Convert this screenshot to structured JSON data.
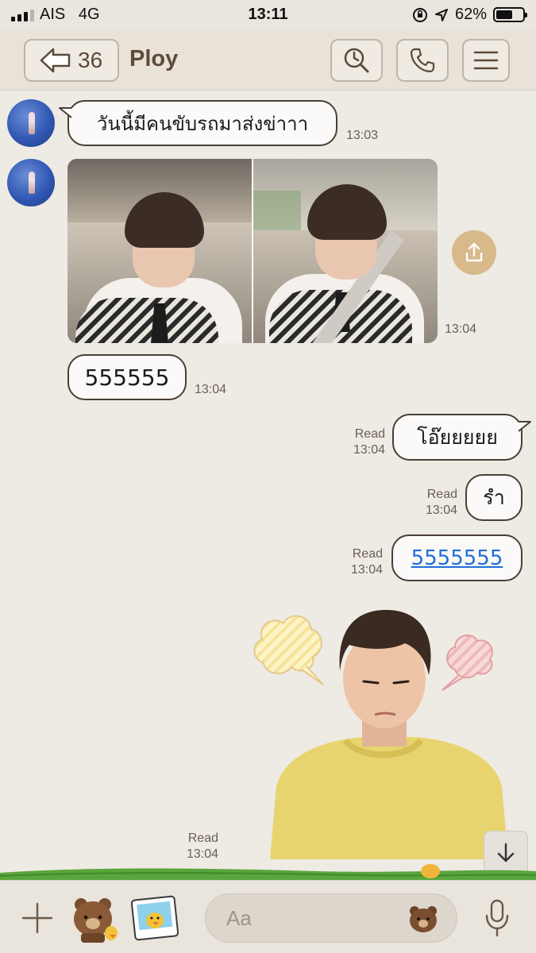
{
  "status_bar": {
    "carrier": "AIS",
    "network": "4G",
    "time": "13:11",
    "battery_text": "62%",
    "battery_level": 0.62
  },
  "header": {
    "back_count": "36",
    "title": "Ploy"
  },
  "messages": [
    {
      "text": "วันนี้มีคนขับรถมาส่งข่าาา",
      "time": "13:03"
    },
    {
      "type": "photos",
      "time": "13:04"
    },
    {
      "text": "555555",
      "time": "13:04"
    },
    {
      "text": "โอ๊ยยยยย",
      "read": "Read",
      "time": "13:04"
    },
    {
      "text": "รำ",
      "read": "Read",
      "time": "13:04"
    },
    {
      "text": "5555555",
      "read": "Read",
      "time": "13:04"
    },
    {
      "type": "sticker",
      "read": "Read",
      "time": "13:04"
    }
  ],
  "input": {
    "placeholder": "Aa"
  },
  "colors": {
    "background": "#eeeae4",
    "header": "#e8e2d9",
    "accent": "#d8b98a",
    "link": "#1f6fd8"
  }
}
